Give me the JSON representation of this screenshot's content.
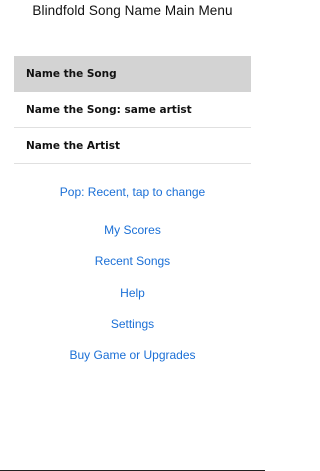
{
  "header": {
    "title": "Blindfold Song Name Main Menu"
  },
  "modes": {
    "items": [
      {
        "label": "Name the Song"
      },
      {
        "label": "Name the Song: same artist"
      },
      {
        "label": "Name the Artist"
      }
    ],
    "selected_index": 0
  },
  "genre": {
    "label": "Pop: Recent, tap to change"
  },
  "menu": {
    "my_scores": "My Scores",
    "recent_songs": "Recent Songs",
    "help": "Help",
    "settings": "Settings",
    "buy": "Buy Game or Upgrades"
  },
  "colors": {
    "link": "#1a6fd6",
    "selected_row": "#d3d3d3"
  }
}
